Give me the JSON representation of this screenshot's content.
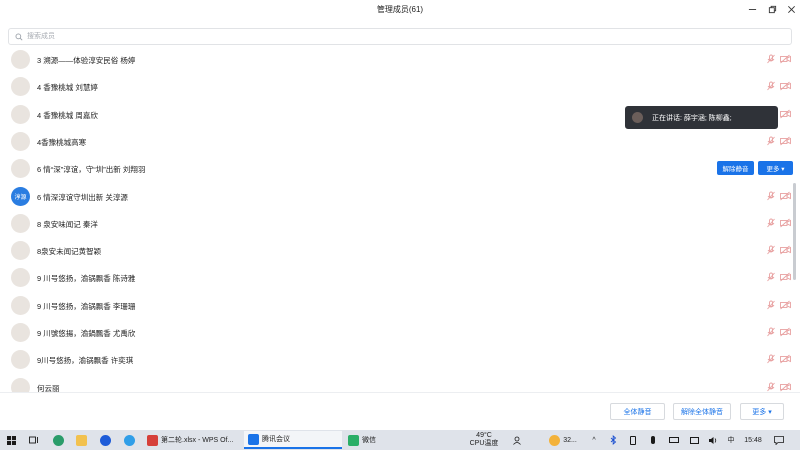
{
  "window": {
    "title": "管理成员(61)"
  },
  "search": {
    "placeholder": "搜索成员"
  },
  "members": [
    {
      "name": "3 溯源——体验淳安民俗 杨婷",
      "avatar_color": "#3a3140",
      "avatar_text": ""
    },
    {
      "name": "4 香豫桃城 刘慧婷",
      "avatar_color": "#2e2e2e",
      "avatar_text": ""
    },
    {
      "name": "4 香豫桃城 周嘉欣",
      "avatar_color": "#e58a6a",
      "avatar_text": ""
    },
    {
      "name": "4香豫桃城高寒",
      "avatar_color": "#7a5a48",
      "avatar_text": ""
    },
    {
      "name": "6 情“深”淳谊，守“圳”出新 刘翔羽",
      "avatar_color": "#8a8a7a",
      "avatar_text": ""
    },
    {
      "name": "6 情深淳谊守圳出新 关淳源",
      "avatar_color": "#2a7de1",
      "avatar_text": "淳源"
    },
    {
      "name": "8 泉安味闻记 秦洋",
      "avatar_color": "#c9a79a",
      "avatar_text": ""
    },
    {
      "name": "8泉安未闻记黄智颖",
      "avatar_color": "#3d3d3d",
      "avatar_text": ""
    },
    {
      "name": "9 川号悠扬，渝锅飘香 陈诗雅",
      "avatar_color": "#c9b097",
      "avatar_text": ""
    },
    {
      "name": "9 川号悠扬，渝锅飘香 李珊珊",
      "avatar_color": "#8a5a4e",
      "avatar_text": ""
    },
    {
      "name": "9 川號悠揚，渝鍋飄香 尤禹欣",
      "avatar_color": "#4f6a7e",
      "avatar_text": ""
    },
    {
      "name": "9川号悠扬，渝锅飘香 许奕琪",
      "avatar_color": "#d8b48a",
      "avatar_text": ""
    },
    {
      "name": "何云丽",
      "avatar_color": "#c96a3a",
      "avatar_text": ""
    }
  ],
  "hover_actions": {
    "unmute_label": "解除静音",
    "more_label": "更多 ▾"
  },
  "speaking": {
    "text": "正在讲话: 薛宇涵; 陈柳鑫;"
  },
  "bottom": {
    "mute_all": "全体静音",
    "unmute_all": "解除全体静音",
    "more": "更多 ▾"
  },
  "taskbar": {
    "apps": [
      {
        "label": "第二轮.xlsx - WPS Of...",
        "color": "#d6403a"
      },
      {
        "label": "腾讯会议",
        "color": "#1a73e8"
      },
      {
        "label": "微信",
        "color": "#2aae67"
      }
    ],
    "temperature": "49°C",
    "cpu_label": "CPU温度",
    "weather": "32...",
    "ime": "中",
    "clock": "15:48"
  },
  "colors": {
    "accent": "#1a73e8",
    "muted_icon": "#e8a2a2"
  }
}
